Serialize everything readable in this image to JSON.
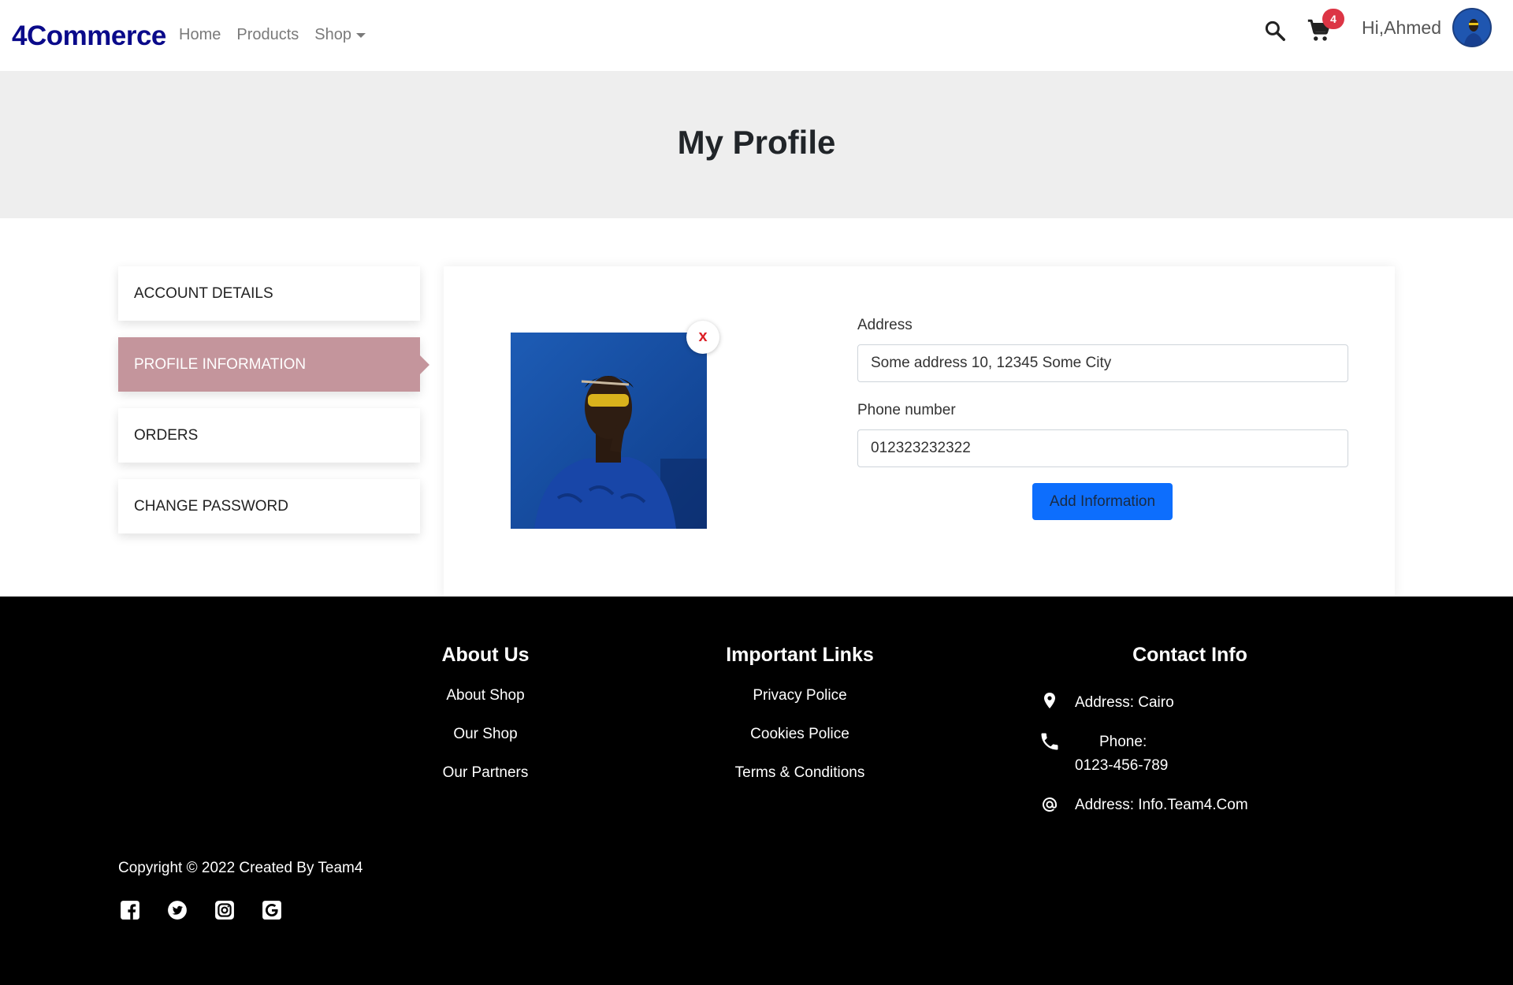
{
  "nav": {
    "brand": "4Commerce",
    "links": [
      "Home",
      "Products",
      "Shop"
    ],
    "cart_count": "4",
    "greeting": "Hi,Ahmed"
  },
  "hero": {
    "title": "My Profile"
  },
  "sidebar": {
    "items": [
      {
        "label": "ACCOUNT DETAILS",
        "active": false
      },
      {
        "label": "PROFILE INFORMATION",
        "active": true
      },
      {
        "label": "ORDERS",
        "active": false
      },
      {
        "label": "CHANGE PASSWORD",
        "active": false
      }
    ]
  },
  "profile": {
    "remove_label": "x",
    "address_label": "Address",
    "address_value": "Some address 10, 12345 Some City",
    "phone_label": "Phone number",
    "phone_value": "012323232322",
    "submit_label": "Add Information"
  },
  "footer": {
    "about": {
      "title": "About Us",
      "links": [
        "About Shop",
        "Our Shop",
        "Our Partners"
      ]
    },
    "links": {
      "title": "Important Links",
      "links": [
        "Privacy Police",
        "Cookies Police",
        "Terms & Conditions"
      ]
    },
    "contact": {
      "title": "Contact Info",
      "address": "Address: Cairo",
      "phone_label": "Phone:",
      "phone_value": "0123-456-789",
      "email": "Address: Info.Team4.Com"
    },
    "copyright": "Copyright © 2022 Created By Team4",
    "social": [
      "facebook-icon",
      "twitter-icon",
      "instagram-icon",
      "google-icon"
    ]
  },
  "colors": {
    "brand": "#0a0a8a",
    "active_tab": "#c4959c",
    "primary_button": "#0d6efd",
    "badge": "#dc3545",
    "footer_bg": "#000000",
    "hero_bg": "#eeeeee"
  }
}
